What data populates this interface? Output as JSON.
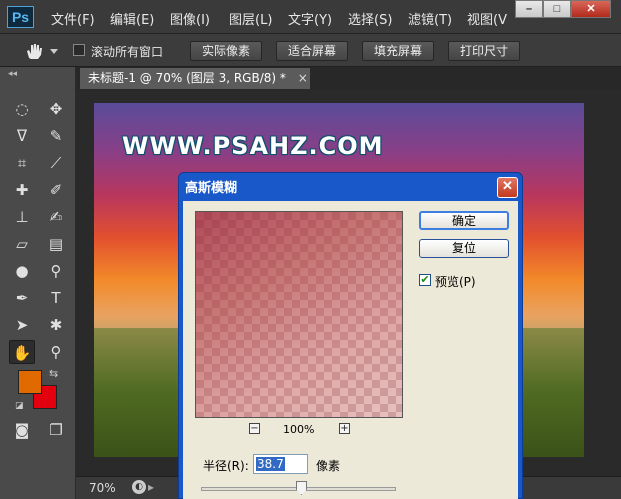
{
  "app": {
    "logo": "Ps"
  },
  "menu": {
    "items": [
      "文件(F)",
      "编辑(E)",
      "图像(I)",
      "图层(L)",
      "文字(Y)",
      "选择(S)",
      "滤镜(T)",
      "视图(V"
    ]
  },
  "window_controls": {
    "minimize": "–",
    "restore": "□",
    "close": "✕"
  },
  "options_bar": {
    "scroll_all_windows": "滚动所有窗口",
    "actual_pixels": "实际像素",
    "fit_screen": "适合屏幕",
    "fill_screen": "填充屏幕",
    "print_size": "打印尺寸"
  },
  "document": {
    "tab_title": "未标题-1 @ 70% (图层 3, RGB/8) *",
    "tab_close": "×",
    "watermark": "WWW.PSAHZ.COM"
  },
  "status_bar": {
    "zoom": "70%"
  },
  "colors": {
    "foreground": "#e06a00",
    "background": "#e3000f"
  },
  "dialog": {
    "title": "高斯模糊",
    "close": "✕",
    "ok_button": "确定",
    "reset_button": "复位",
    "preview_label": "预览(P)",
    "preview_checked": true,
    "zoom_level": "100%",
    "zoom_out": "−",
    "zoom_in": "+",
    "radius_label": "半径(R):",
    "radius_value": "38.7",
    "radius_unit": "像素"
  }
}
